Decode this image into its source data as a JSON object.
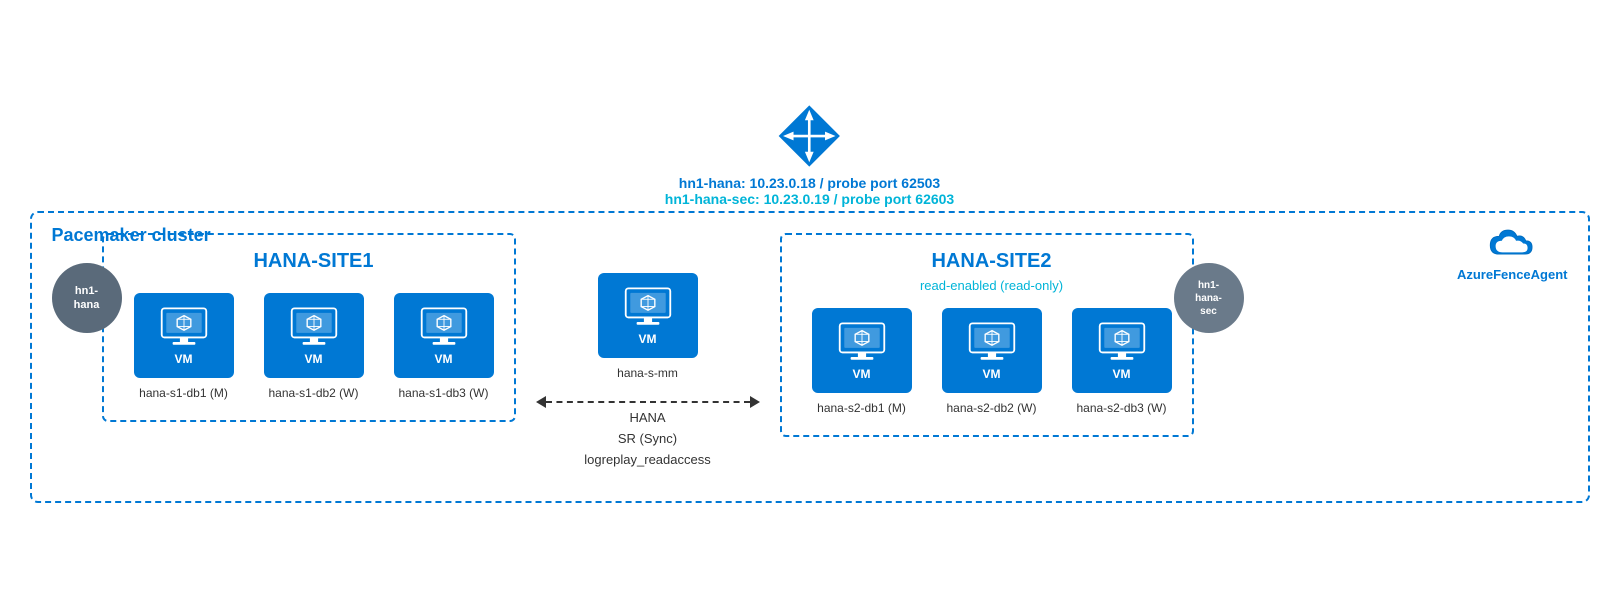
{
  "diagram": {
    "title": "Pacemaker cluster",
    "router": {
      "primary_label": "hn1-hana:  10.23.0.18 / probe port 62503",
      "secondary_label": "hn1-hana-sec:  10.23.0.19 / probe port 62603"
    },
    "fence_agent": {
      "label": "AzureFenceAgent"
    },
    "site1": {
      "title": "HANA-SITE1",
      "node": {
        "label": "hn1-\nhana"
      },
      "vms": [
        {
          "label": "hana-s1-db1 (M)"
        },
        {
          "label": "hana-s1-db2 (W)"
        },
        {
          "label": "hana-s1-db3 (W)"
        }
      ]
    },
    "middle": {
      "vm_label": "hana-s-mm"
    },
    "site2": {
      "title": "HANA-SITE2",
      "subtitle": "read-enabled (read-only)",
      "node": {
        "label": "hn1-\nhana-\nsec"
      },
      "vms": [
        {
          "label": "hana-s2-db1 (M)"
        },
        {
          "label": "hana-s2-db2 (W)"
        },
        {
          "label": "hana-s2-db3 (W)"
        }
      ]
    },
    "sync": {
      "line1": "HANA",
      "line2": "SR (Sync)",
      "line3": "logreplay_readaccess"
    },
    "vm_text": "VM"
  }
}
